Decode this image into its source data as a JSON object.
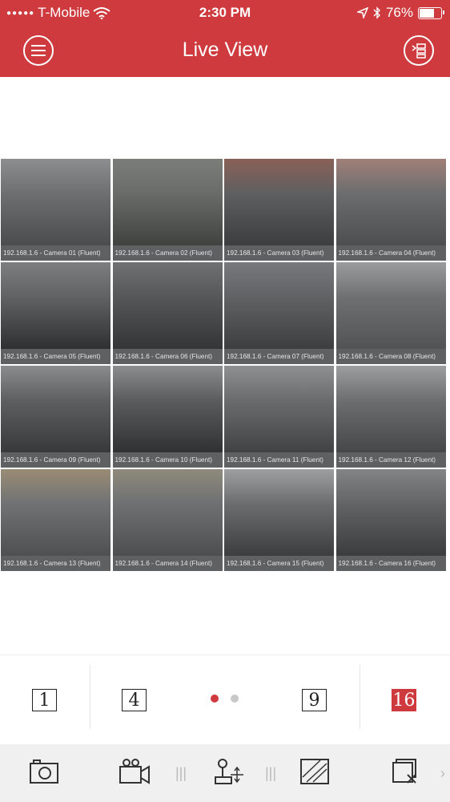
{
  "status_bar": {
    "carrier": "T-Mobile",
    "time": "2:30 PM",
    "battery": "76%",
    "battery_level": 0.76
  },
  "header": {
    "title": "Live View"
  },
  "cameras": [
    {
      "label": "192.168.1.6 - Camera 01 (Fluent)",
      "selected": false
    },
    {
      "label": "192.168.1.6 - Camera 02 (Fluent)",
      "selected": false
    },
    {
      "label": "192.168.1.6 - Camera 03 (Fluent)",
      "selected": true
    },
    {
      "label": "192.168.1.6 - Camera 04 (Fluent)",
      "selected": false
    },
    {
      "label": "192.168.1.6 - Camera 05 (Fluent)",
      "selected": false
    },
    {
      "label": "192.168.1.6 - Camera 06 (Fluent)",
      "selected": false
    },
    {
      "label": "192.168.1.6 - Camera 07 (Fluent)",
      "selected": false
    },
    {
      "label": "192.168.1.6 - Camera 08 (Fluent)",
      "selected": false
    },
    {
      "label": "192.168.1.6 - Camera 09 (Fluent)",
      "selected": false
    },
    {
      "label": "192.168.1.6 - Camera 10 (Fluent)",
      "selected": false
    },
    {
      "label": "192.168.1.6 - Camera 11 (Fluent)",
      "selected": false
    },
    {
      "label": "192.168.1.6 - Camera 12 (Fluent)",
      "selected": false
    },
    {
      "label": "192.168.1.6 - Camera 13 (Fluent)",
      "selected": false
    },
    {
      "label": "192.168.1.6 - Camera 14 (Fluent)",
      "selected": false
    },
    {
      "label": "192.168.1.6 - Camera 15 (Fluent)",
      "selected": false
    },
    {
      "label": "192.168.1.6 - Camera 16 (Fluent)",
      "selected": false
    }
  ],
  "layout_options": {
    "one": "1",
    "four": "4",
    "nine": "9",
    "sixteen": "16"
  },
  "pager": {
    "pages": 2,
    "current": 1
  },
  "colors": {
    "accent": "#cf3a3e",
    "selected_outline": "#e8b400"
  },
  "toolbar_icons": [
    "camera-snapshot-icon",
    "video-record-icon",
    "ptz-joystick-icon",
    "image-quality-icon",
    "close-all-icon"
  ]
}
